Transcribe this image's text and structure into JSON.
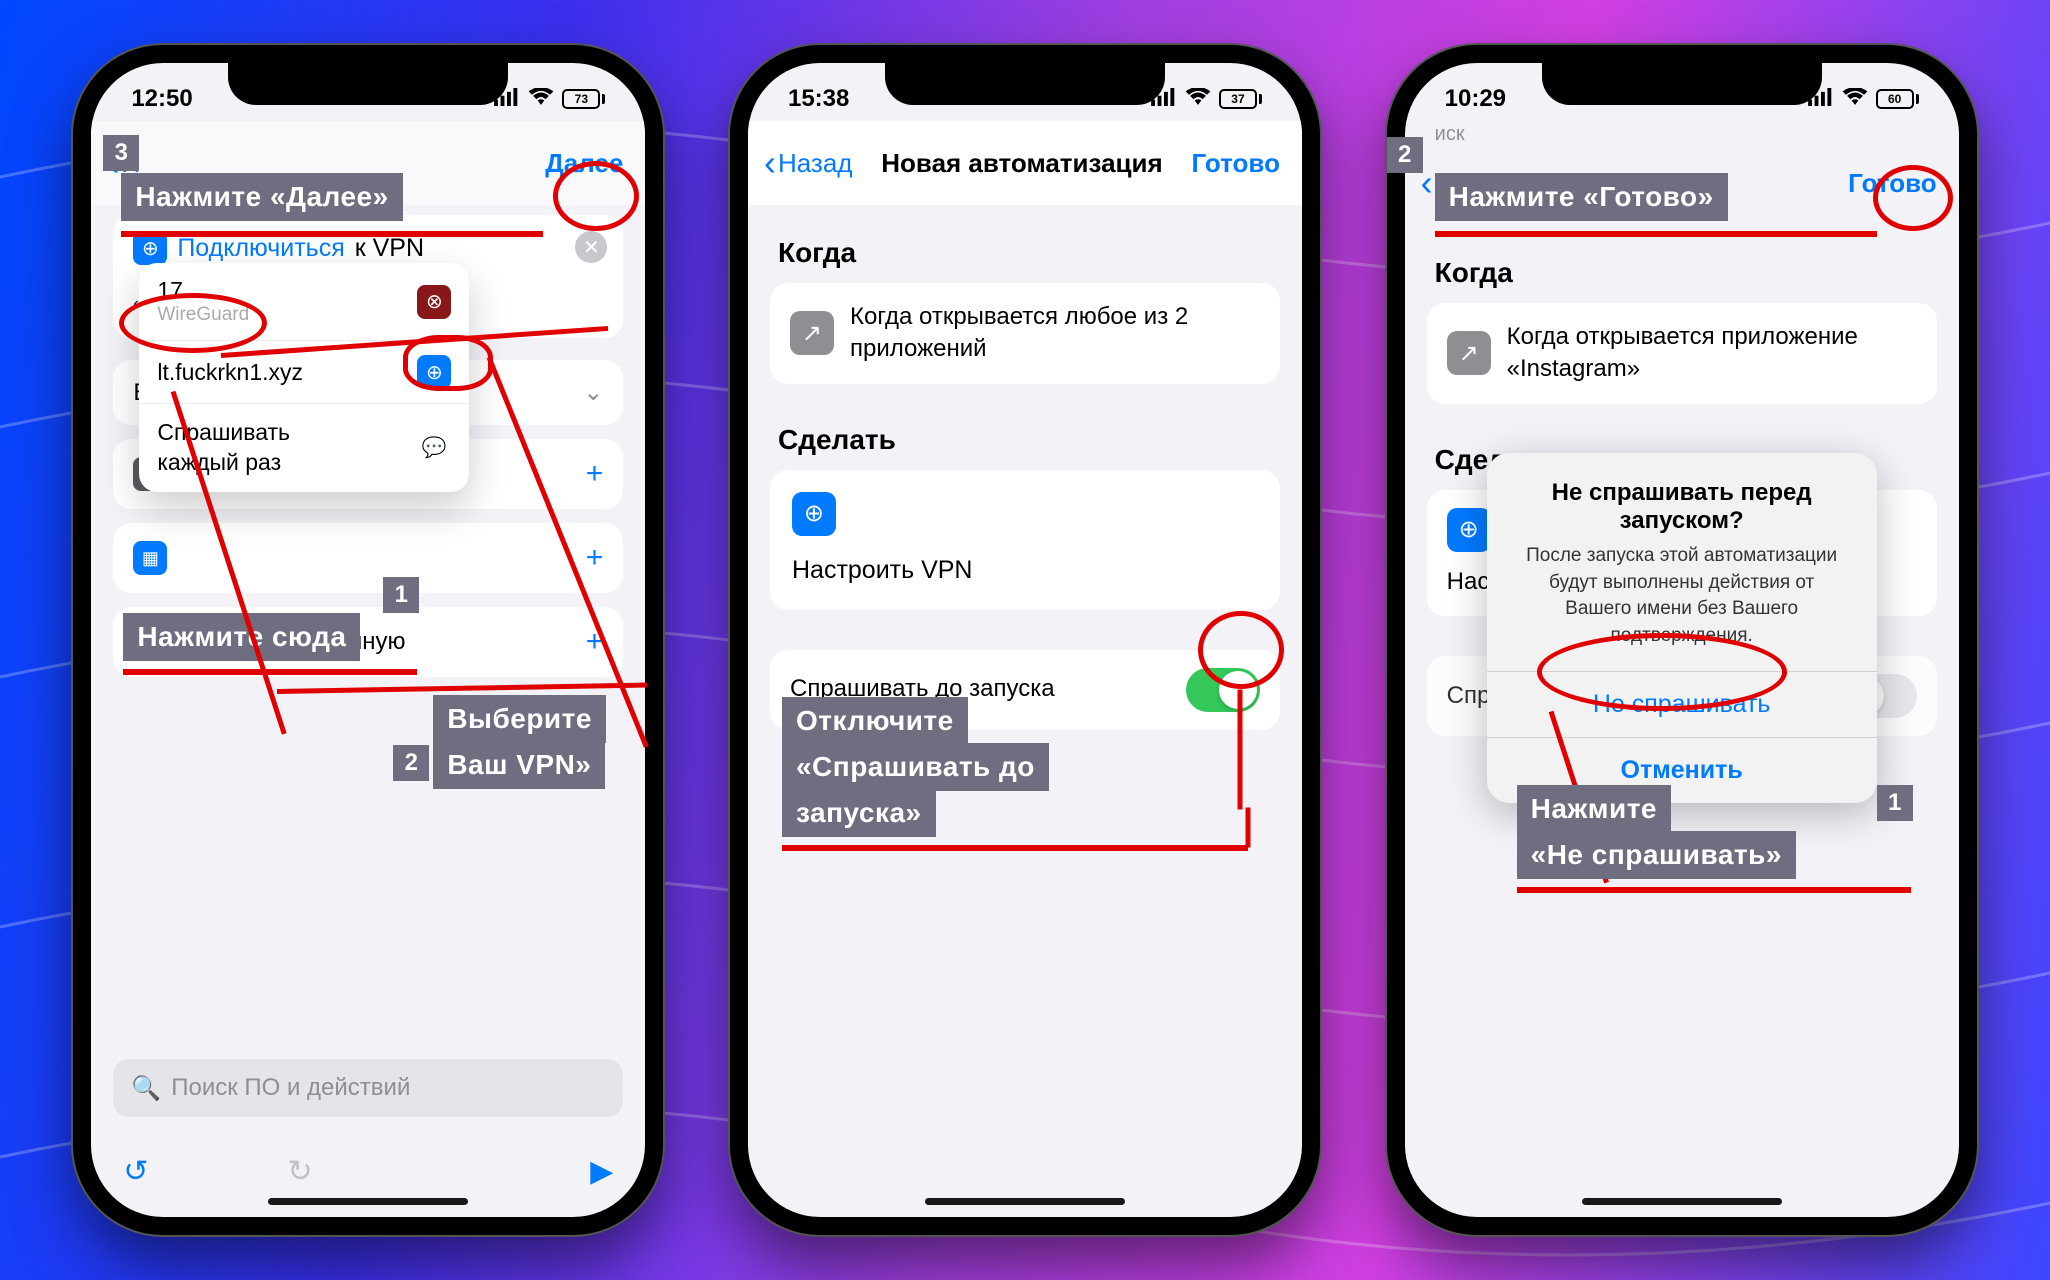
{
  "phone1": {
    "time": "12:50",
    "battery": "73",
    "nav": {
      "back": "Н",
      "next": "Далее"
    },
    "action": {
      "verb": "Подключиться",
      "suffix": "к VPN",
      "chip": "VPN"
    },
    "popup": {
      "r1_badge": "17",
      "r1_sub": "WireGuard",
      "r2": "lt.fuckrkn1.xyz",
      "r3": "Спрашивать каждый раз"
    },
    "vars_label": "Ва",
    "rows": {
      "r2": "",
      "r3": "",
      "r4": "Задать переменную"
    },
    "search_ph": "Поиск ПО и действий",
    "ann": {
      "step3_num": "3",
      "step3": "Нажмите «Далее»",
      "step1_num": "1",
      "step1": "Нажмите сюда",
      "step2_num": "2",
      "step2_l1": "Выберите",
      "step2_l2": "Ваш VPN»"
    }
  },
  "phone2": {
    "time": "15:38",
    "battery": "37",
    "nav": {
      "back": "Назад",
      "title": "Новая автоматизация",
      "done": "Готово"
    },
    "when_h": "Когда",
    "when_text": "Когда открывается любое из 2 приложений",
    "do_h": "Сделать",
    "do_text": "Настроить VPN",
    "ask": "Спрашивать до запуска",
    "ann": {
      "l1": "Отключите",
      "l2": "«Спрашивать до",
      "l3": "запуска»"
    }
  },
  "phone3": {
    "time": "10:29",
    "battery": "60",
    "search_hint": "иск",
    "nav": {
      "back": "",
      "done": "Готово"
    },
    "when_h": "Когда",
    "when_text": "Когда открывается приложение «Instagram»",
    "do_h": "Сделать",
    "do_text": "Наст",
    "ask_short": "Спр",
    "alert": {
      "title": "Не спрашивать перед запуском?",
      "msg": "После запуска этой автоматизации будут выполнены действия от Вашего имени без Вашего подтверждения.",
      "b1": "Не спрашивать",
      "b2": "Отменить"
    },
    "ann": {
      "step2_num": "2",
      "step2": "Нажмите «Готово»",
      "step1_num": "1",
      "step1_l1": "Нажмите",
      "step1_l2": "«Не спрашивать»"
    }
  }
}
